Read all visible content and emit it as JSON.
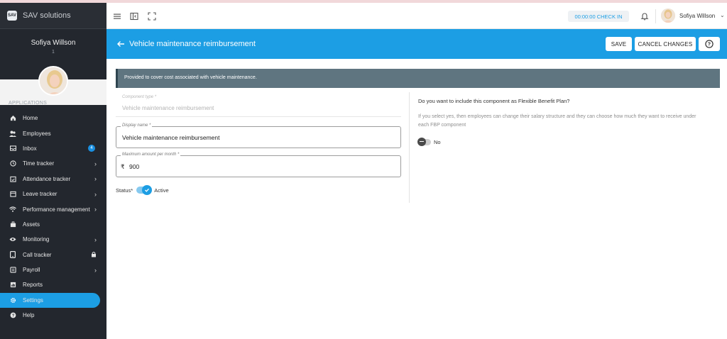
{
  "app": {
    "brand": "SAV solutions",
    "logo_text": "SAV"
  },
  "sidebar": {
    "user_name": "Sofiya Willson",
    "user_id": "1",
    "section_label": "APPLICATIONS",
    "items": [
      {
        "label": "Home",
        "icon": "home-icon",
        "chevron": false
      },
      {
        "label": "Employees",
        "icon": "people-icon",
        "chevron": false
      },
      {
        "label": "Inbox",
        "icon": "mail-icon",
        "chevron": false,
        "badge": "4"
      },
      {
        "label": "Time tracker",
        "icon": "clock-icon",
        "chevron": true
      },
      {
        "label": "Attendance tracker",
        "icon": "calendar-check-icon",
        "chevron": true
      },
      {
        "label": "Leave tracker",
        "icon": "calendar-icon",
        "chevron": true
      },
      {
        "label": "Performance management",
        "icon": "wifi-icon",
        "chevron": true
      },
      {
        "label": "Assets",
        "icon": "briefcase-icon",
        "chevron": false
      },
      {
        "label": "Monitoring",
        "icon": "eye-icon",
        "chevron": true
      },
      {
        "label": "Call tracker",
        "icon": "phone-icon",
        "chevron": false,
        "locked": true
      },
      {
        "label": "Payroll",
        "icon": "wallet-icon",
        "chevron": true
      },
      {
        "label": "Reports",
        "icon": "report-icon",
        "chevron": false
      },
      {
        "label": "Settings",
        "icon": "gear-icon",
        "chevron": false,
        "active": true
      },
      {
        "label": "Help",
        "icon": "help-icon",
        "chevron": false
      }
    ]
  },
  "topbar": {
    "checkin_label": "00:00:00 CHECK IN",
    "user_name": "Sofiya Willson"
  },
  "header": {
    "title": "Vehicle maintenance reimbursement",
    "save_label": "SAVE",
    "cancel_label": "CANCEL CHANGES",
    "help_label": "?"
  },
  "info_banner": "Provided to cover cost associated with vehicle maintenance.",
  "form": {
    "component_type_label": "Component type *",
    "component_type_value": "Vehicle maintenance reimbursement",
    "display_name_label": "Display name *",
    "display_name_value": "Vehicle maintenance reimbursement",
    "max_amount_label": "Maximum amount per month *",
    "currency_symbol": "₹",
    "max_amount_value": "900",
    "status_label": "Status*",
    "status_value": "Active"
  },
  "fbp": {
    "question": "Do you want to include this component as Flexible Benefit Plan?",
    "description": "If you select yes, then employees can change their salary structure and they can choose how much they want to receive under each FBP component",
    "toggle_label": "No"
  },
  "colors": {
    "accent": "#1c9ee4",
    "sidebar_bg": "#23272e",
    "banner_bg": "#5f7580"
  }
}
